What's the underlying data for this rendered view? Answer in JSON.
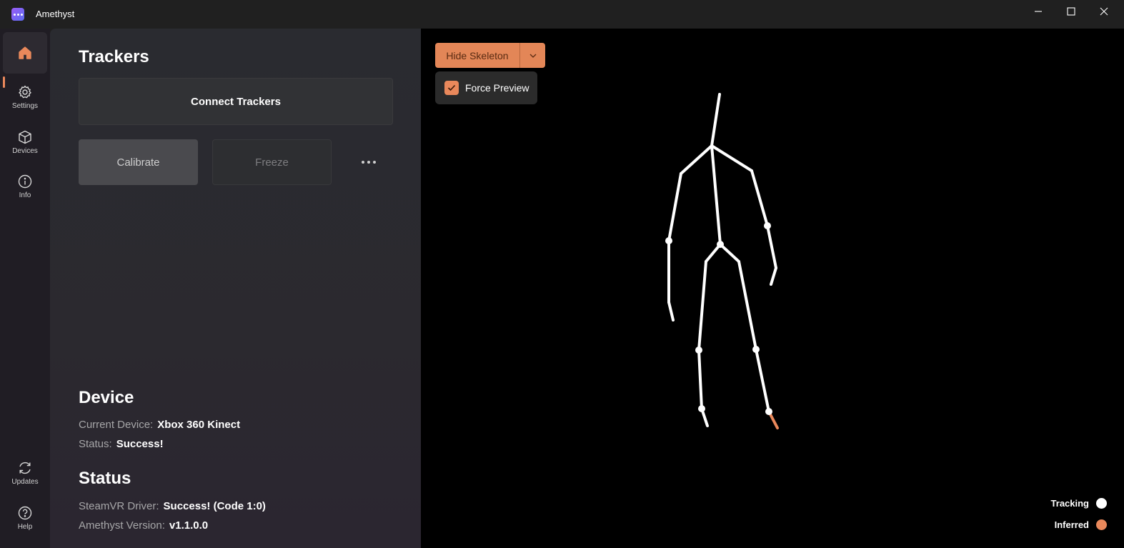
{
  "window": {
    "title": "Amethyst"
  },
  "nav": {
    "home": "Home",
    "settings": "Settings",
    "devices": "Devices",
    "info": "Info",
    "updates": "Updates",
    "help": "Help"
  },
  "trackers": {
    "heading": "Trackers",
    "connect_label": "Connect Trackers",
    "calibrate_label": "Calibrate",
    "freeze_label": "Freeze"
  },
  "device": {
    "heading": "Device",
    "current_device_key": "Current Device:",
    "current_device_value": "Xbox 360 Kinect",
    "status_key": "Status:",
    "status_value": "Success!"
  },
  "status": {
    "heading": "Status",
    "driver_key": "SteamVR Driver:",
    "driver_value": "Success! (Code 1:0)",
    "version_key": "Amethyst Version:",
    "version_value": "v1.1.0.0"
  },
  "preview": {
    "hide_skeleton_label": "Hide Skeleton",
    "force_preview_label": "Force Preview",
    "force_preview_checked": true,
    "legend_tracking": "Tracking",
    "legend_inferred": "Inferred"
  },
  "colors": {
    "accent": "#e9885b",
    "tracking": "#ffffff",
    "inferred": "#e9885b"
  }
}
